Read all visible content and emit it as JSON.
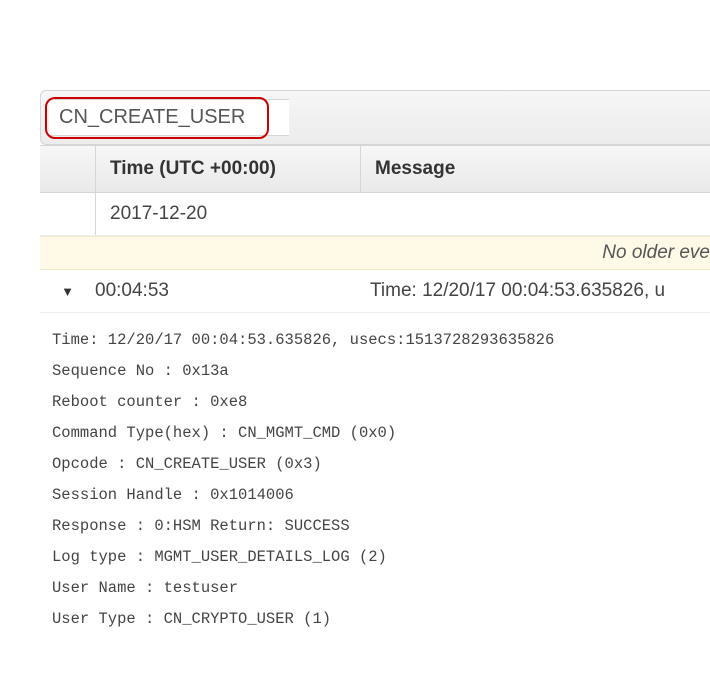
{
  "search": {
    "value": "CN_CREATE_USER"
  },
  "table": {
    "headers": {
      "time": "Time (UTC +00:00)",
      "message": "Message"
    },
    "date_group": "2017-12-20",
    "no_older_text": "No older eve",
    "event": {
      "time": "00:04:53",
      "message": "Time: 12/20/17 00:04:53.635826, u"
    }
  },
  "details": {
    "lines": [
      "Time: 12/20/17 00:04:53.635826, usecs:1513728293635826",
      "Sequence No : 0x13a",
      "Reboot counter : 0xe8",
      "Command Type(hex) : CN_MGMT_CMD (0x0)",
      "Opcode : CN_CREATE_USER (0x3)",
      "Session Handle : 0x1014006",
      "Response : 0:HSM Return: SUCCESS",
      "Log type : MGMT_USER_DETAILS_LOG (2)",
      "User Name : testuser",
      "User Type : CN_CRYPTO_USER (1)"
    ]
  }
}
